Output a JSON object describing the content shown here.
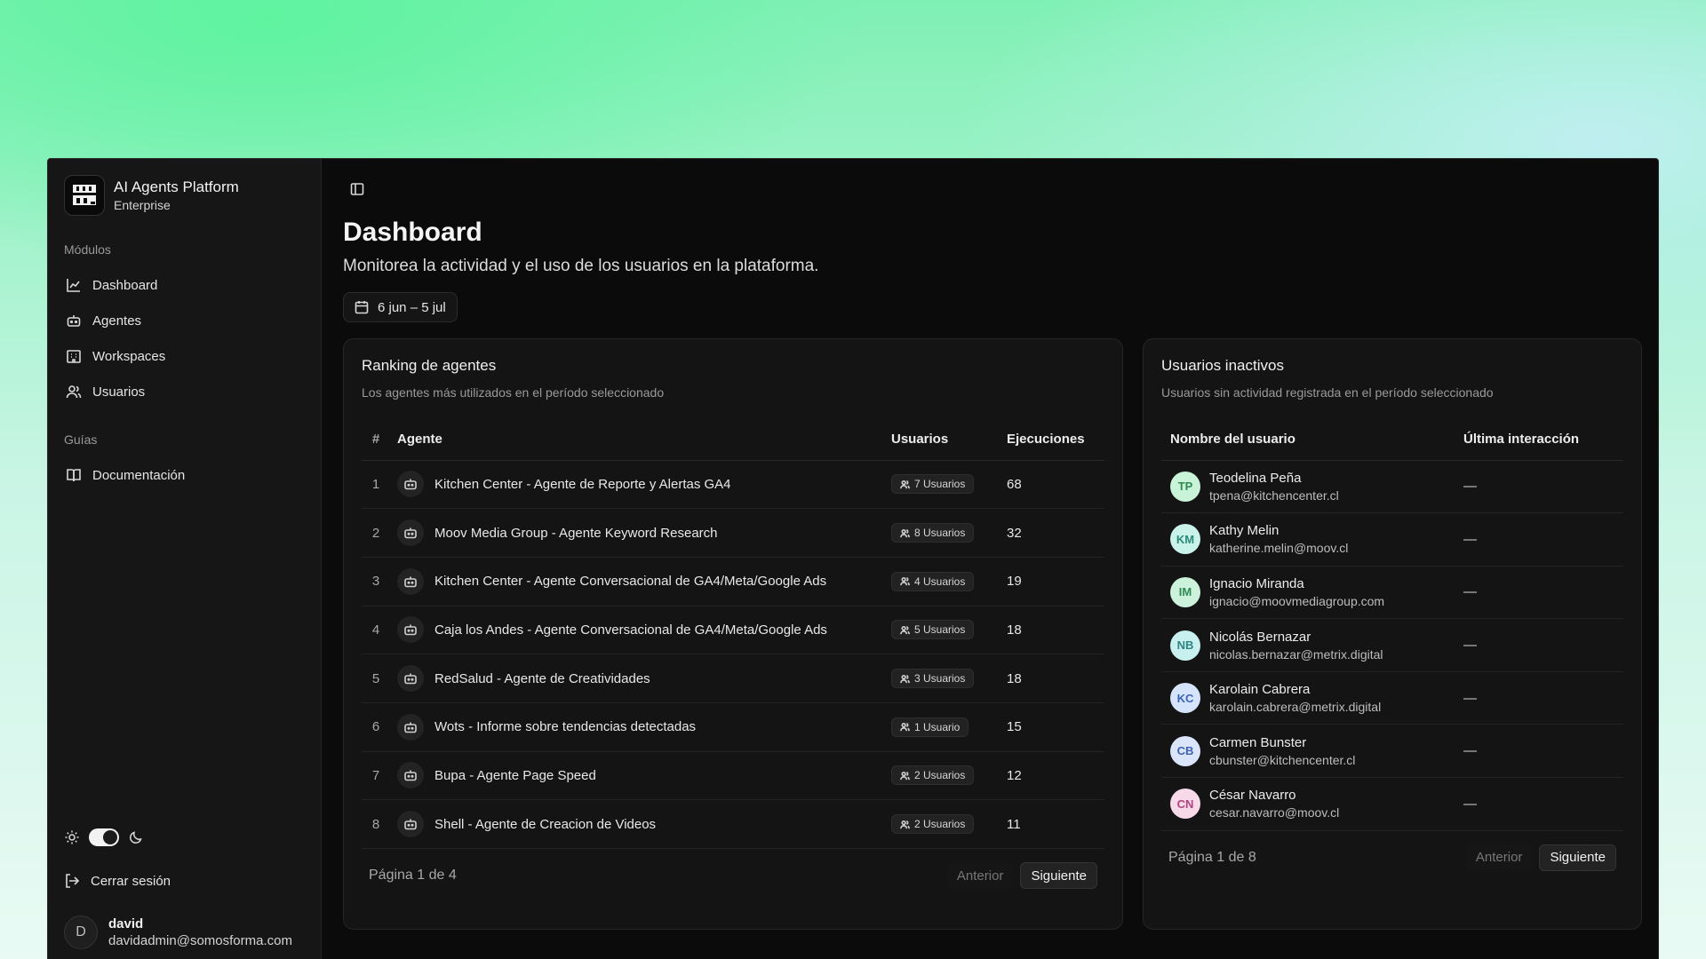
{
  "brand": {
    "title": "AI Agents Platform",
    "subtitle": "Enterprise"
  },
  "sidebar": {
    "modules_label": "Módulos",
    "items": [
      {
        "label": "Dashboard",
        "icon": "chart-icon"
      },
      {
        "label": "Agentes",
        "icon": "bot-icon"
      },
      {
        "label": "Workspaces",
        "icon": "building-icon"
      },
      {
        "label": "Usuarios",
        "icon": "users-icon"
      }
    ],
    "guides_label": "Guías",
    "guides": [
      {
        "label": "Documentación",
        "icon": "book-icon"
      }
    ],
    "logout_label": "Cerrar sesión",
    "user": {
      "initial": "D",
      "name": "david",
      "email": "davidadmin@somosforma.com"
    }
  },
  "header": {
    "title": "Dashboard",
    "subtitle": "Monitorea la actividad y el uso de los usuarios en la plataforma.",
    "date_range": "6 jun – 5 jul"
  },
  "ranking": {
    "title": "Ranking de agentes",
    "subtitle": "Los agentes más utilizados en el período seleccionado",
    "columns": {
      "num": "#",
      "agent": "Agente",
      "users": "Usuarios",
      "runs": "Ejecuciones"
    },
    "rows": [
      {
        "num": "1",
        "agent": "Kitchen Center - Agente de Reporte y Alertas GA4",
        "users": "7 Usuarios",
        "runs": "68"
      },
      {
        "num": "2",
        "agent": "Moov Media Group - Agente Keyword Research",
        "users": "8 Usuarios",
        "runs": "32"
      },
      {
        "num": "3",
        "agent": "Kitchen Center - Agente Conversacional de GA4/Meta/Google Ads",
        "users": "4 Usuarios",
        "runs": "19"
      },
      {
        "num": "4",
        "agent": "Caja los Andes - Agente Conversacional de GA4/Meta/Google Ads",
        "users": "5 Usuarios",
        "runs": "18"
      },
      {
        "num": "5",
        "agent": "RedSalud - Agente de Creatividades",
        "users": "3 Usuarios",
        "runs": "18"
      },
      {
        "num": "6",
        "agent": "Wots - Informe sobre tendencias detectadas",
        "users": "1 Usuario",
        "runs": "15"
      },
      {
        "num": "7",
        "agent": "Bupa - Agente Page Speed",
        "users": "2 Usuarios",
        "runs": "12"
      },
      {
        "num": "8",
        "agent": "Shell - Agente de Creacion de Videos",
        "users": "2 Usuarios",
        "runs": "11"
      }
    ],
    "pager": {
      "text": "Página 1 de 4",
      "prev": "Anterior",
      "next": "Siguiente"
    }
  },
  "inactive": {
    "title": "Usuarios inactivos",
    "subtitle": "Usuarios sin actividad registrada en el período seleccionado",
    "columns": {
      "name": "Nombre del usuario",
      "last": "Última interacción"
    },
    "rows": [
      {
        "initials": "TP",
        "name": "Teodelina Peña",
        "email": "tpena@kitchencenter.cl",
        "last": "—",
        "bg": "#c9f3d9",
        "fg": "#2f8a52"
      },
      {
        "initials": "KM",
        "name": "Kathy Melin",
        "email": "katherine.melin@moov.cl",
        "last": "—",
        "bg": "#c9f3ea",
        "fg": "#2a8a78"
      },
      {
        "initials": "IM",
        "name": "Ignacio Miranda",
        "email": "ignacio@moovmediagroup.com",
        "last": "—",
        "bg": "#cdf2dc",
        "fg": "#2e8a55"
      },
      {
        "initials": "NB",
        "name": "Nicolás Bernazar",
        "email": "nicolas.bernazar@metrix.digital",
        "last": "—",
        "bg": "#c8f0ee",
        "fg": "#2b8583"
      },
      {
        "initials": "KC",
        "name": "Karolain Cabrera",
        "email": "karolain.cabrera@metrix.digital",
        "last": "—",
        "bg": "#d6e4fb",
        "fg": "#3a64b8"
      },
      {
        "initials": "CB",
        "name": "Carmen Bunster",
        "email": "cbunster@kitchencenter.cl",
        "last": "—",
        "bg": "#dbe5fa",
        "fg": "#3e62ad"
      },
      {
        "initials": "CN",
        "name": "César Navarro",
        "email": "cesar.navarro@moov.cl",
        "last": "—",
        "bg": "#f8d9ea",
        "fg": "#b2437f"
      }
    ],
    "pager": {
      "text": "Página 1 de 8",
      "prev": "Anterior",
      "next": "Siguiente"
    }
  }
}
